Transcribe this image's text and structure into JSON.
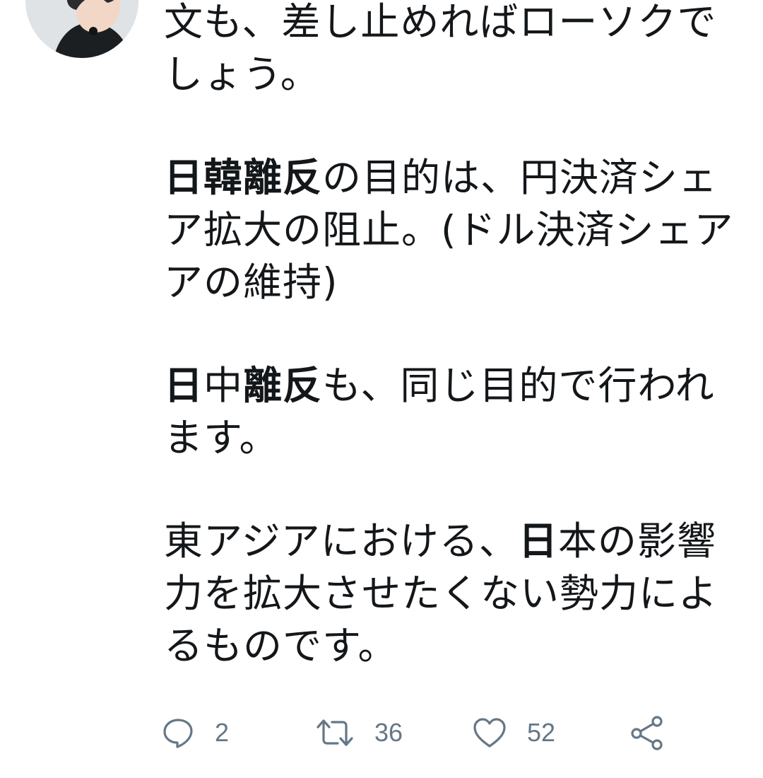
{
  "tweet": {
    "lines": [
      {
        "segments": [
          {
            "text": "文も、差し止めればローソクで",
            "bold": false
          }
        ]
      },
      {
        "segments": [
          {
            "text": "しょう。",
            "bold": false
          }
        ]
      },
      {
        "gap": true
      },
      {
        "segments": [
          {
            "text": "日韓離反",
            "bold": true
          },
          {
            "text": "の目的は、円決済シェ",
            "bold": false
          }
        ]
      },
      {
        "segments": [
          {
            "text": "ア拡大の阻止。(ドル決済シェア",
            "bold": false
          }
        ]
      },
      {
        "segments": [
          {
            "text": "アの維持)",
            "bold": false
          }
        ]
      },
      {
        "gap": true
      },
      {
        "segments": [
          {
            "text": "日",
            "bold": true
          },
          {
            "text": "中",
            "bold": false
          },
          {
            "text": "離反",
            "bold": true
          },
          {
            "text": "も、同じ目的で行われ",
            "bold": false
          }
        ]
      },
      {
        "segments": [
          {
            "text": "ます。",
            "bold": false
          }
        ]
      },
      {
        "gap": true
      },
      {
        "segments": [
          {
            "text": "東アジアにおける、",
            "bold": false
          },
          {
            "text": "日",
            "bold": true
          },
          {
            "text": "本の影響",
            "bold": false
          }
        ]
      },
      {
        "segments": [
          {
            "text": "力を拡大させたくない勢力によ",
            "bold": false
          }
        ]
      },
      {
        "segments": [
          {
            "text": "るものです。",
            "bold": false
          }
        ]
      }
    ]
  },
  "actions": {
    "reply": {
      "icon": "reply-icon",
      "count": "2"
    },
    "retweet": {
      "icon": "retweet-icon",
      "count": "36"
    },
    "like": {
      "icon": "heart-icon",
      "count": "52"
    },
    "share": {
      "icon": "share-icon"
    }
  },
  "colors": {
    "text": "#14171a",
    "muted": "#657786",
    "background": "#ffffff"
  }
}
